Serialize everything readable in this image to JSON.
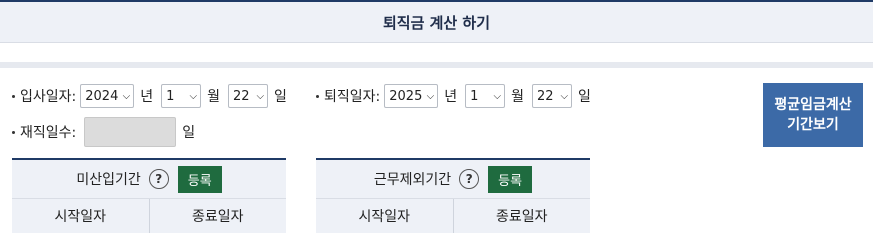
{
  "header": {
    "title": "퇴직금 계산 하기"
  },
  "hire": {
    "label": "입사일자:",
    "year": "2024",
    "year_unit": "년",
    "month": "1",
    "month_unit": "월",
    "day": "22",
    "day_unit": "일"
  },
  "retire": {
    "label": "퇴직일자:",
    "year": "2025",
    "year_unit": "년",
    "month": "1",
    "month_unit": "월",
    "day": "22",
    "day_unit": "일"
  },
  "tenure": {
    "label": "재직일수:",
    "value": "",
    "unit": "일"
  },
  "calc_button": {
    "line1": "평균임금계산",
    "line2": "기간보기"
  },
  "panels": [
    {
      "title": "미산입기간",
      "help": "?",
      "register": "등록",
      "col_start": "시작일자",
      "col_end": "종료일자"
    },
    {
      "title": "근무제외기간",
      "help": "?",
      "register": "등록",
      "col_start": "시작일자",
      "col_end": "종료일자"
    }
  ],
  "colors": {
    "accent": "#1f3a66",
    "calc_button": "#3c6aa7",
    "register_button": "#1f6b3f",
    "header_bg": "#eef1f7"
  }
}
